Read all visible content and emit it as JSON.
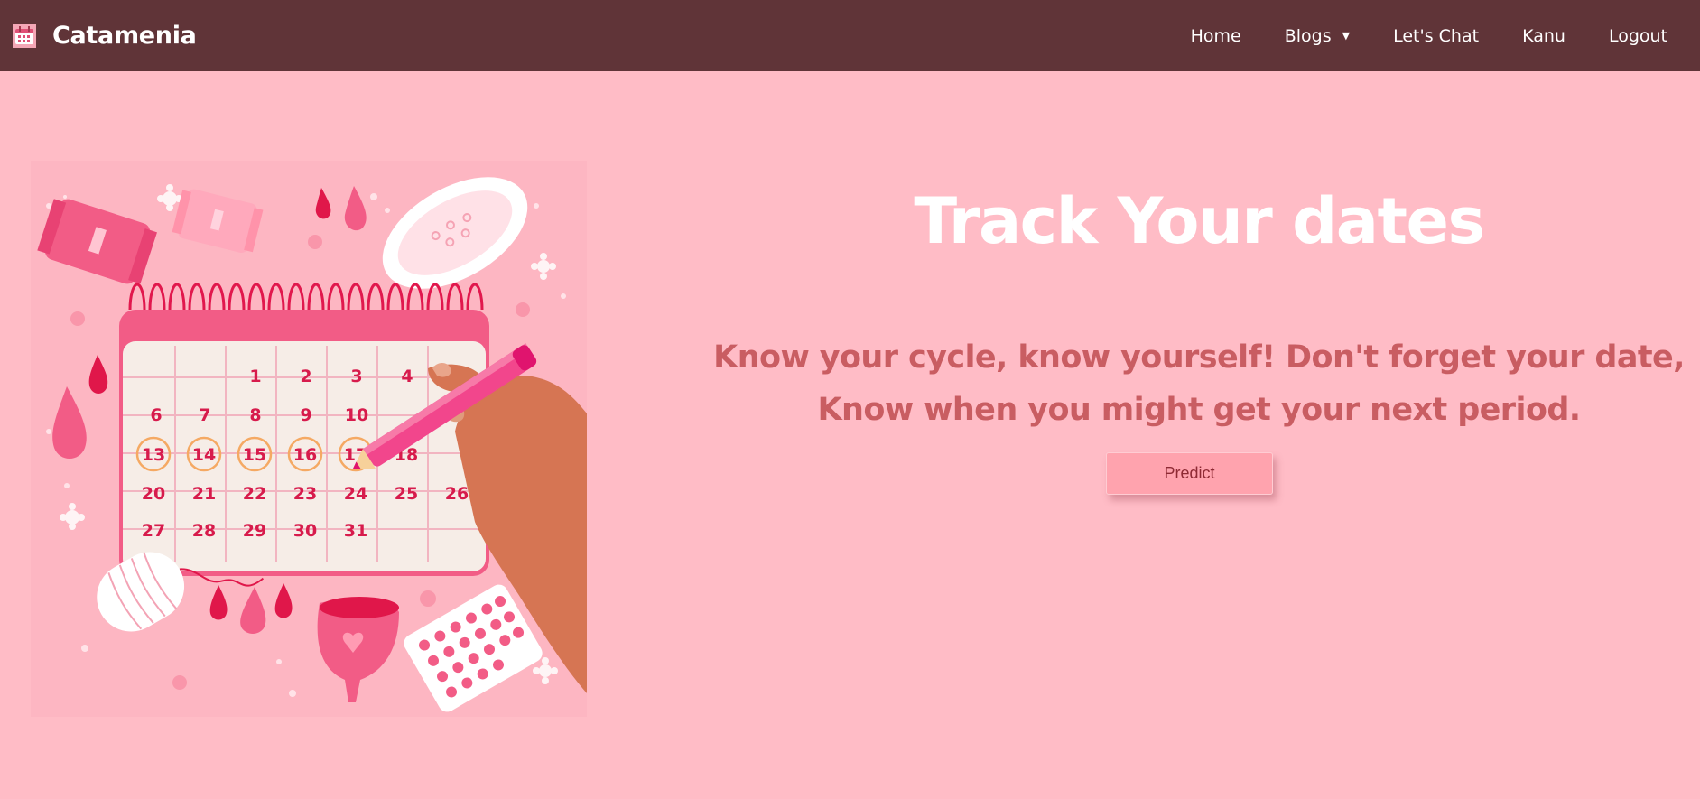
{
  "navbar": {
    "brand_name": "Catamenia",
    "links": {
      "home": "Home",
      "blogs": "Blogs",
      "chat": "Let's Chat",
      "user": "Kanu",
      "logout": "Logout"
    }
  },
  "hero": {
    "title": "Track Your dates",
    "subtitle": "Know your cycle, know yourself! Don't forget your date, Know when you might get your next period.",
    "predict_button": "Predict"
  },
  "calendar": {
    "days": [
      "1",
      "2",
      "3",
      "4",
      "6",
      "7",
      "8",
      "9",
      "10",
      "13",
      "14",
      "15",
      "16",
      "17",
      "18",
      "20",
      "21",
      "22",
      "23",
      "24",
      "25",
      "26",
      "27",
      "28",
      "29",
      "30",
      "31"
    ]
  },
  "colors": {
    "navbar_bg": "#603438",
    "page_bg": "#ffbcc6",
    "title_color": "#ffffff",
    "subtitle_color": "#c95d62",
    "button_bg": "#ffa3ae"
  }
}
